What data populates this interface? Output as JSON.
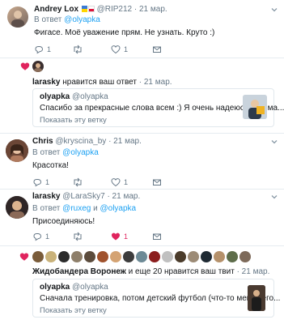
{
  "colors": {
    "accent": "#1da1f2",
    "heart": "#e0245e",
    "muted": "#657786"
  },
  "tweet1": {
    "name": "Andrey Lox",
    "handle": "@RIP212",
    "date": "· 21 мар.",
    "reply_prefix": "В ответ",
    "reply_to": "@olyapka",
    "text": "Фигасе. Моё уважение прям. Не узнать. Круто :)",
    "reply_count": "1",
    "retweet_count": "",
    "like_count": "1"
  },
  "activity1": {
    "actor": "larasky",
    "text": "нравится ваш ответ",
    "date": "· 21 мар.",
    "quoted": {
      "name": "olyapka",
      "handle": "@olyapka",
      "text": "Спасибо за прекрасные слова всем :) Я очень надеюсь, что ма...",
      "show_thread": "Показать эту ветку"
    }
  },
  "tweet2": {
    "name": "Chris",
    "handle": "@kryscina_by",
    "date": "· 21 мар.",
    "reply_prefix": "В ответ",
    "reply_to": "@olyapka",
    "text": "Красотка!",
    "reply_count": "1",
    "retweet_count": "",
    "like_count": "1"
  },
  "tweet3": {
    "name": "larasky",
    "handle": "@LaraSky7",
    "date": "· 21 мар.",
    "reply_prefix": "В ответ",
    "reply_to_1": "@ruxeg",
    "reply_and": "и",
    "reply_to_2": "@olyapka",
    "text": "Присоединяюсь!",
    "reply_count": "1",
    "retweet_count": "",
    "like_count": "1"
  },
  "activity2": {
    "actor": "Жидобандера Воронеж",
    "text": "и еще 20 нравится ваш твит",
    "date": "· 21 мар.",
    "quoted": {
      "name": "olyapka",
      "handle": "@olyapka",
      "text": "Сначала тренировка, потом детский футбол (что-то меня сего...",
      "show_thread": "Показать эту ветку"
    }
  }
}
